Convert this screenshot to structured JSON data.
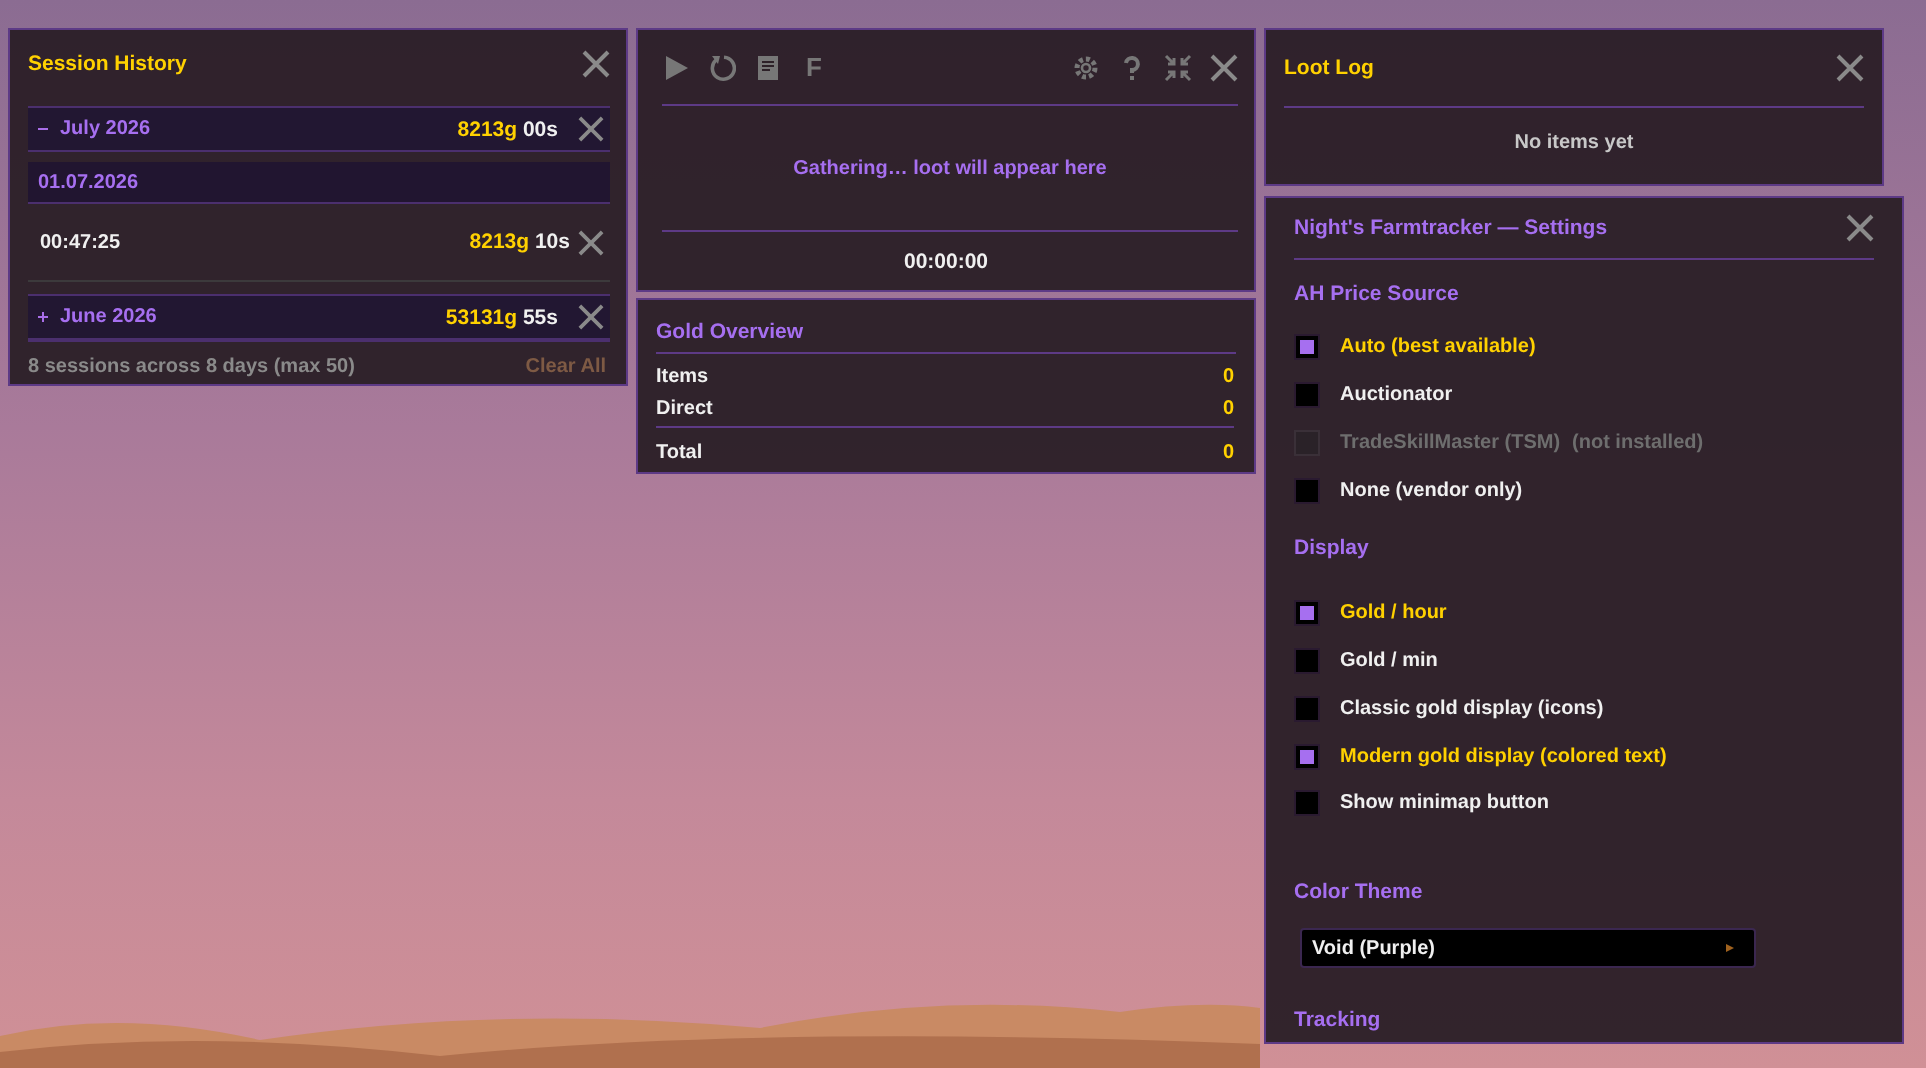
{
  "session_history": {
    "title": "Session History",
    "months": [
      {
        "label": "July 2026",
        "expanded": true,
        "gold": "8213g",
        "silver": "00s",
        "days": [
          {
            "label": "01.07.2026",
            "sessions": [
              {
                "time": "00:47:25",
                "gold": "8213g",
                "silver": "10s"
              }
            ]
          }
        ]
      },
      {
        "label": "June 2026",
        "expanded": false,
        "gold": "53131g",
        "silver": "55s"
      }
    ],
    "footer": "8 sessions across 8 days (max 50)",
    "clear_all": "Clear All"
  },
  "tracker": {
    "toolbar_label": "F",
    "status_text": "Gathering… loot will appear here",
    "timer": "00:00:00"
  },
  "gold_overview": {
    "title": "Gold Overview",
    "rows": [
      {
        "label": "Items",
        "value": "0"
      },
      {
        "label": "Direct",
        "value": "0"
      }
    ],
    "total": {
      "label": "Total",
      "value": "0"
    }
  },
  "loot_log": {
    "title": "Loot Log",
    "empty_text": "No items yet"
  },
  "settings": {
    "title": "Night's Farmtracker — Settings",
    "sections": [
      {
        "heading": "AH Price Source",
        "items": [
          {
            "kind": "checkbox",
            "label": "Auto (best available)",
            "checked": true,
            "disabled": false
          },
          {
            "kind": "checkbox",
            "label": "Auctionator",
            "checked": false,
            "disabled": false
          },
          {
            "kind": "checkbox",
            "label": "TradeSkillMaster (TSM)",
            "note": "(not installed)",
            "checked": false,
            "disabled": true
          },
          {
            "kind": "checkbox",
            "label": "None (vendor only)",
            "checked": false,
            "disabled": false
          }
        ]
      },
      {
        "heading": "Display",
        "items": [
          {
            "kind": "checkbox",
            "label": "Gold / hour",
            "checked": true,
            "disabled": false
          },
          {
            "kind": "checkbox",
            "label": "Gold / min",
            "checked": false,
            "disabled": false
          },
          {
            "kind": "checkbox",
            "label": "Classic gold display (icons)",
            "checked": false,
            "disabled": false
          },
          {
            "kind": "checkbox",
            "label": "Modern gold display (colored text)",
            "checked": true,
            "disabled": false
          },
          {
            "kind": "checkbox",
            "label": "Show minimap button",
            "checked": false,
            "disabled": false
          }
        ]
      },
      {
        "heading": "Color Theme",
        "items": [
          {
            "kind": "dropdown",
            "value": "Void (Purple)"
          }
        ]
      },
      {
        "heading": "Tracking"
      }
    ]
  }
}
